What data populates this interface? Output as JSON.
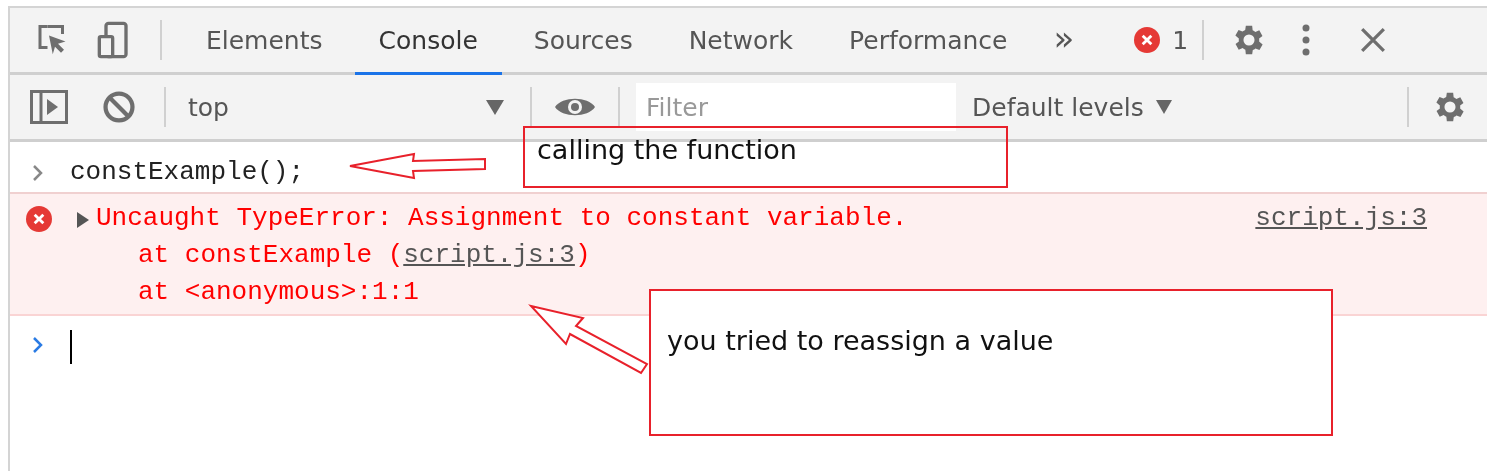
{
  "tabs": [
    {
      "label": "Elements",
      "selected": false
    },
    {
      "label": "Console",
      "selected": true
    },
    {
      "label": "Sources",
      "selected": false
    },
    {
      "label": "Network",
      "selected": false
    },
    {
      "label": "Performance",
      "selected": false
    }
  ],
  "more_tabs": "»",
  "error_count": "1",
  "context": "top",
  "filter": {
    "placeholder": "Filter"
  },
  "levels": "Default levels",
  "messages": [
    {
      "kind": "input",
      "text": "constExample();"
    },
    {
      "kind": "error",
      "expanded": false,
      "text": "Uncaught TypeError: Assignment to constant variable.",
      "source": "script.js:3",
      "stack": [
        {
          "prefix": "at constExample (",
          "link": "script.js:3",
          "suffix": ")"
        },
        {
          "prefix": "at <anonymous>:1:1"
        }
      ]
    }
  ],
  "annotations": [
    {
      "text": "calling the function"
    },
    {
      "text": "you tried to reassign a value"
    }
  ]
}
